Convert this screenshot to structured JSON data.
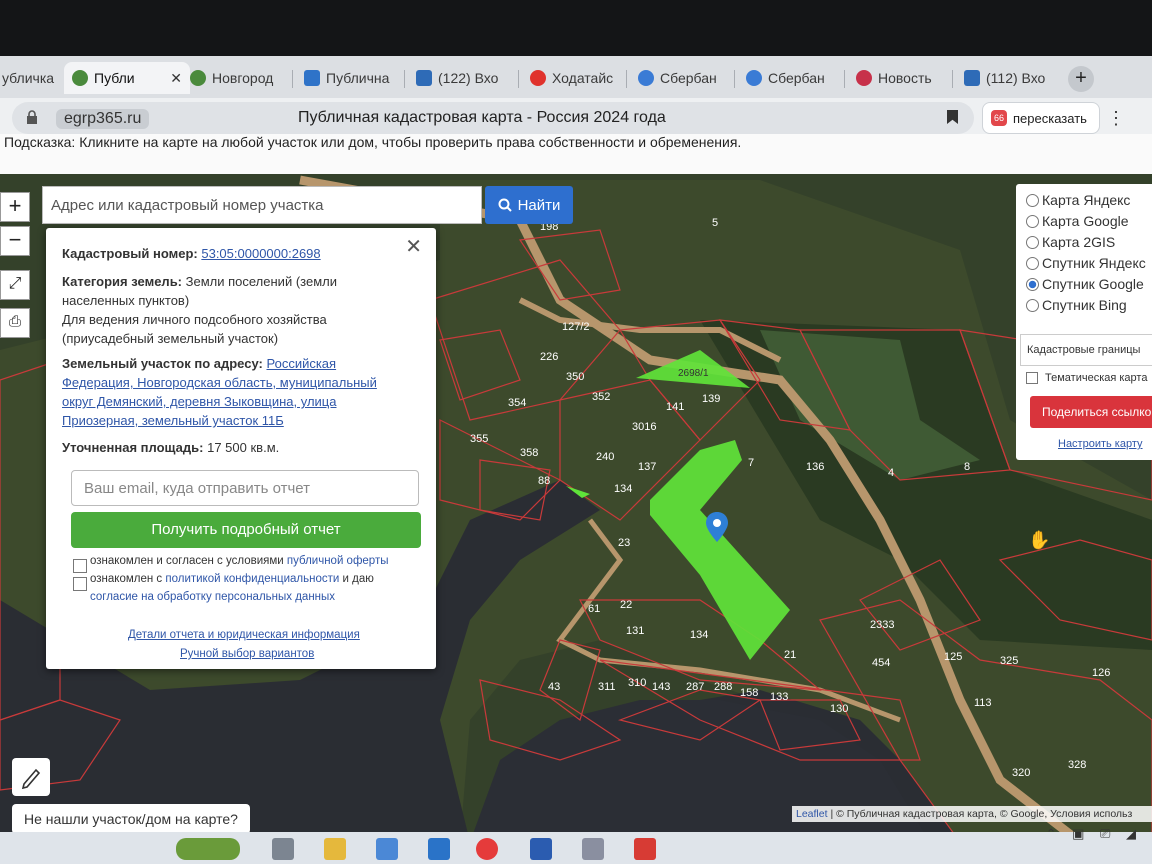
{
  "browser": {
    "tabs": [
      {
        "label": "убличка",
        "icon": "tab-icon",
        "color": "#e08a2b"
      },
      {
        "label": "Публи",
        "icon": "check-icon",
        "color": "#4a8a3c",
        "active": true
      },
      {
        "label": "Новгород",
        "icon": "check-icon",
        "color": "#4a8a3c"
      },
      {
        "label": "Публична",
        "icon": "map-icon",
        "color": "#2f73c8"
      },
      {
        "label": "(122) Вхо",
        "icon": "mail-icon",
        "color": "#2e6bb7"
      },
      {
        "label": "Ходатайс",
        "icon": "youtube-icon",
        "color": "#e0322c"
      },
      {
        "label": "Сбербан",
        "icon": "chrome-icon",
        "color": "#3a7bd5"
      },
      {
        "label": "Сбербан",
        "icon": "chrome-icon",
        "color": "#3a7bd5"
      },
      {
        "label": "Новость",
        "icon": "news-icon",
        "color": "#c7314a"
      },
      {
        "label": "(112) Вхо",
        "icon": "mail-icon",
        "color": "#2e6bb7"
      }
    ],
    "new_tab": "+",
    "host": "egrp365.ru",
    "page_title": "Публичная кадастровая карта - Россия 2024 года",
    "retell": "пересказать",
    "menu": "⋮"
  },
  "hint": "Подсказка: Кликните на карте на любой участок или дом, чтобы проверить права собственности и обременения.",
  "map": {
    "zoom_in": "+",
    "zoom_out": "−",
    "search_placeholder": "Адрес или кадастровый номер участка",
    "search_button": "Найти",
    "parcel_label": "2698/1",
    "plot_numbers": [
      "198",
      "5",
      "127/2",
      "226",
      "350",
      "354",
      "355",
      "141",
      "139",
      "136",
      "4",
      "8",
      "7",
      "137",
      "134",
      "88",
      "23",
      "22",
      "61",
      "131",
      "134",
      "21",
      "311",
      "310",
      "143",
      "287",
      "288",
      "158",
      "133",
      "43",
      "130",
      "2333",
      "454",
      "125",
      "325",
      "126",
      "113",
      "320",
      "328",
      "3016",
      "352",
      "240",
      "358"
    ],
    "not_found": "Не нашли участок/дом на карте?",
    "attribution_leaflet": "Leaflet",
    "attribution_rest": "| © Публичная кадастровая карта, © Google, Условия использ"
  },
  "popup": {
    "close": "✕",
    "cad_label": "Кадастровый номер:",
    "cad_value": "53:05:0000000:2698",
    "category_label": "Категория земель:",
    "category_value": "Земли поселений (земли населенных пунктов)",
    "usage": "Для ведения личного подсобного хозяйства (приусадебный земельный участок)",
    "address_label": "Земельный участок по адресу:",
    "address_value": "Российская Федерация, Новгородская область, муниципальный округ Демянский, деревня Зыковщина, улица Приозерная, земельный участок 11Б",
    "area_label": "Уточненная площадь:",
    "area_value": "17 500 кв.м.",
    "email_placeholder": "Ваш email, куда отправить отчет",
    "get_report": "Получить подробный отчет",
    "consent1_prefix": "ознакомлен и согласен с условиями",
    "consent1_link": "публичной оферты",
    "consent2_prefix": "ознакомлен с",
    "consent2_link": "политикой конфиденциальности",
    "consent2_mid": "и даю",
    "consent2_link2": "согласие на обработку персональных данных",
    "details_link": "Детали отчета и юридическая информация",
    "manual_link": "Ручной выбор вариантов"
  },
  "layers": {
    "options": [
      {
        "label": "Карта Яндекс",
        "selected": false
      },
      {
        "label": "Карта Google",
        "selected": false
      },
      {
        "label": "Карта 2GIS",
        "selected": false
      },
      {
        "label": "Спутник Яндекс",
        "selected": false
      },
      {
        "label": "Спутник Google",
        "selected": true
      },
      {
        "label": "Спутник Bing",
        "selected": false
      }
    ],
    "boundaries": "Кадастровые границы",
    "thematic": "Тематическая карта",
    "share": "Поделиться ссылкой",
    "setup": "Настроить карту"
  },
  "colors": {
    "accent": "#4aab3c",
    "link": "#2f56a8",
    "parcel": "#5fe33a",
    "boundary": "#c83a3a",
    "share": "#d9343c"
  }
}
